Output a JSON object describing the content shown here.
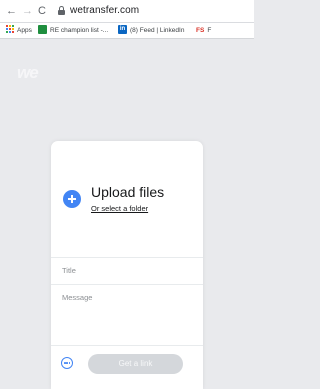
{
  "browser": {
    "url": "wetransfer.com",
    "nav": {
      "back": "←",
      "forward": "→",
      "reload": "C"
    },
    "bookmarks": [
      {
        "label": "Apps",
        "icon": "apps-grid-icon"
      },
      {
        "label": "RE champion list -...",
        "icon": "sheets-icon"
      },
      {
        "label": "(8) Feed | LinkedIn",
        "icon": "linkedin-icon",
        "badge": "in"
      },
      {
        "label": "F",
        "icon": "fs-icon",
        "badge": "FS"
      }
    ]
  },
  "page": {
    "logo": "we"
  },
  "upload_card": {
    "title": "Upload files",
    "select_folder": "Or select a folder",
    "title_placeholder": "Title",
    "message_placeholder": "Message",
    "submit_label": "Get a link"
  },
  "colors": {
    "accent": "#4285f4",
    "page_bg": "#e9eaed",
    "button_disabled": "#d4d7db"
  }
}
